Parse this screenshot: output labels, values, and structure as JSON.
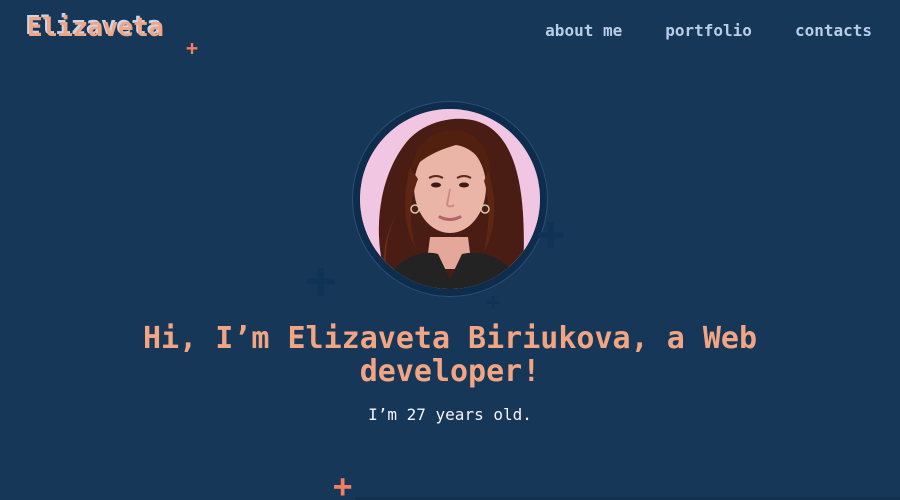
{
  "header": {
    "logo_text": "Elizaveta",
    "nav": [
      {
        "label": "about me"
      },
      {
        "label": "portfolio"
      },
      {
        "label": "contacts"
      }
    ]
  },
  "hero": {
    "headline": "Hi, I’m Elizaveta Biriukova, a Web developer!",
    "subline": "I’m 27 years old."
  },
  "colors": {
    "background": "#173758",
    "accent": "#f2a582",
    "nav_text": "#b9cde8",
    "plus_dark": "#0f3354",
    "plus_accent": "#f07f62"
  },
  "icons": {
    "decorations": [
      "plus-icon",
      "plus-icon",
      "plus-icon",
      "plus-icon",
      "plus-icon"
    ]
  }
}
